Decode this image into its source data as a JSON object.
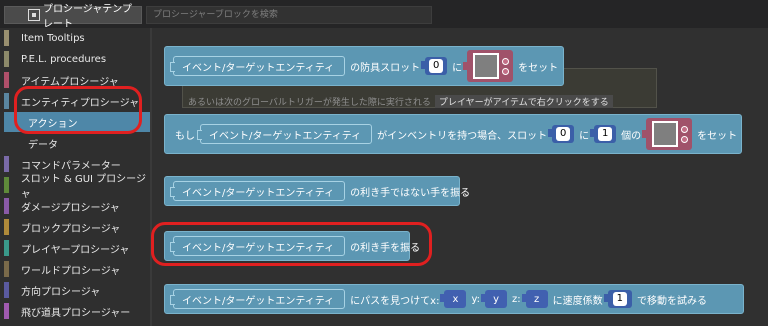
{
  "toolbar": {
    "templates_tab_label": "プロシージャテンプレート",
    "search_placeholder": "プロシージャーブロックを検索"
  },
  "sidebar": {
    "items": [
      {
        "label": "Item Tooltips",
        "color": "#9a9070"
      },
      {
        "label": "P.E.L. procedures",
        "color": "#8d8a6a"
      },
      {
        "label": "アイテムプロシージャ",
        "color": "#b0506a"
      },
      {
        "label": "エンティティプロシージャ",
        "color": "#5a86a0"
      },
      {
        "label": "アクション",
        "color": "#4e87a8"
      },
      {
        "label": "データ",
        "color": ""
      },
      {
        "label": "コマンドパラメーター",
        "color": "#7a6aa8"
      },
      {
        "label": "スロット & GUI プロシージャ",
        "color": "#5f8a3a"
      },
      {
        "label": "ダメージプロシージャ",
        "color": "#8a5aa8"
      },
      {
        "label": "ブロックプロシージャ",
        "color": "#b08a3a"
      },
      {
        "label": "プレイヤープロシージャ",
        "color": "#3a9a8a"
      },
      {
        "label": "ワールドプロシージャ",
        "color": "#7a6a4a"
      },
      {
        "label": "方向プロシージャ",
        "color": "#5a5aa0"
      },
      {
        "label": "飛び道具プロシージャー",
        "color": "#a05ab0"
      }
    ]
  },
  "workspace": {
    "block1": {
      "entity": "イベント/ターゲットエンティティ",
      "t1": "の防具スロット",
      "slot": "0",
      "t2": "に",
      "t3": "をセット"
    },
    "comment": {
      "text": "あるいは次のグローバルトリガーが発生した際に実行される",
      "trigger": "プレイヤーがアイテムで右クリックをする"
    },
    "block2": {
      "t0": "もし",
      "entity": "イベント/ターゲットエンティティ",
      "t1": "がインベントリを持つ場合、スロット",
      "slot": "0",
      "t2": "に",
      "count": "1",
      "t3": "個の",
      "t4": "をセット"
    },
    "block3": {
      "entity": "イベント/ターゲットエンティティ",
      "t1": "の利き手ではない手を振る"
    },
    "block4": {
      "entity": "イベント/ターゲットエンティティ",
      "t1": "の利き手を振る"
    },
    "block5": {
      "entity": "イベント/ターゲットエンティティ",
      "t1": "にパスを見つけてx:",
      "x": "x",
      "t2": "y:",
      "y": "y",
      "t3": "z:",
      "z": "z",
      "t4": "に速度係数",
      "speed": "1",
      "t5": "で移動を試みる"
    }
  }
}
